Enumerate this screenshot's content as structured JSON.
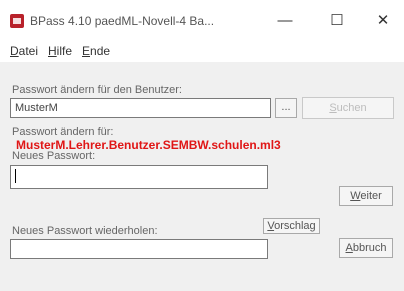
{
  "window": {
    "title": "BPass 4.10 paedML-Novell-4 Ba...",
    "minimize_glyph": "—",
    "maximize_glyph": "☐",
    "close_glyph": "✕"
  },
  "menu": [
    {
      "accel": "D",
      "rest": "atei"
    },
    {
      "accel": "H",
      "rest": "ilfe"
    },
    {
      "accel": "E",
      "rest": "nde"
    }
  ],
  "user_section": {
    "label": "Passwort ändern für den Benutzer:",
    "value": "MusterM",
    "browse_label": "...",
    "search_accel": "S",
    "search_rest": "uchen"
  },
  "change_for": {
    "label": "Passwort ändern für:",
    "target": "MusterM.Lehrer.Benutzer.SEMBW.schulen.ml3"
  },
  "new_password": {
    "label": "Neues Passwort:",
    "value": ""
  },
  "repeat_password": {
    "label": "Neues Passwort wiederholen:",
    "value": ""
  },
  "buttons": {
    "next_accel": "W",
    "next_rest": "eiter",
    "suggest_accel": "V",
    "suggest_rest": "orschlag",
    "cancel_accel": "A",
    "cancel_rest": "bbruch"
  },
  "colors": {
    "accent_red": "#e01616",
    "icon_red": "#b8212a"
  }
}
